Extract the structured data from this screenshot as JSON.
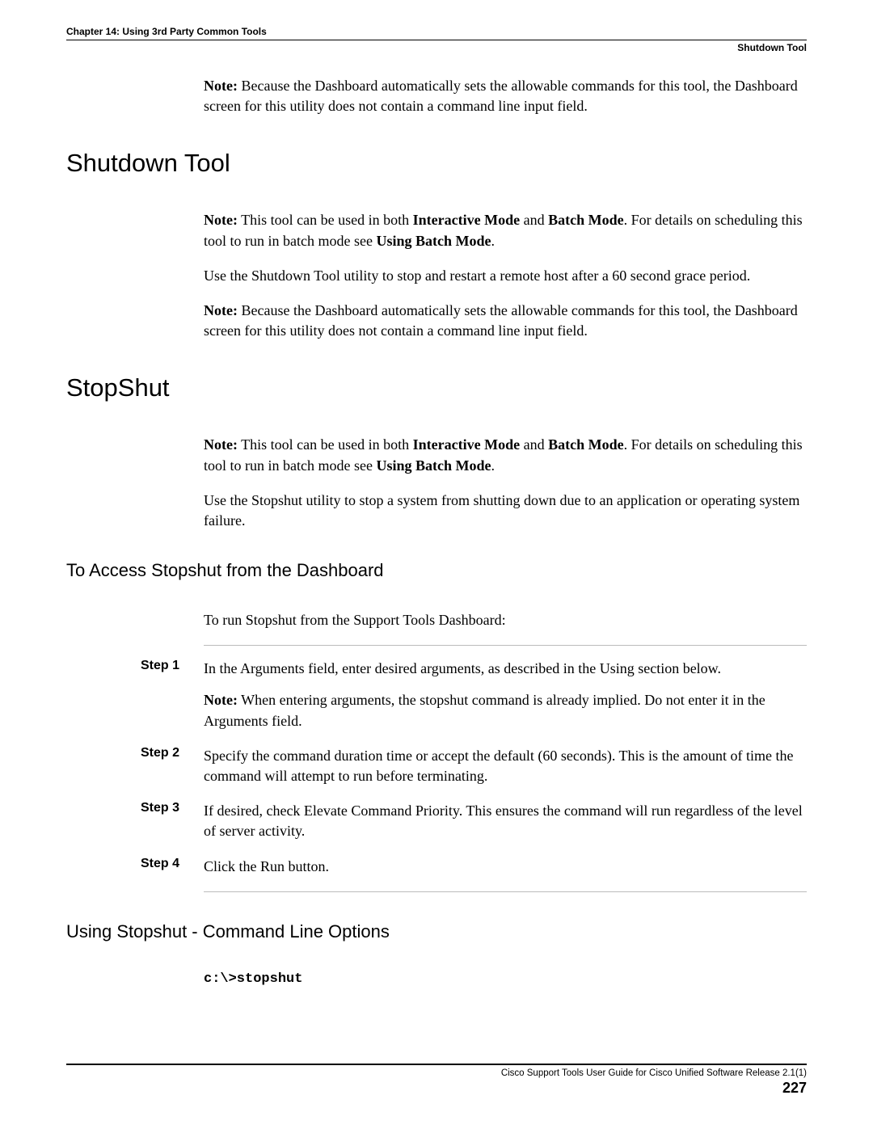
{
  "header": {
    "chapter": "Chapter 14: Using 3rd Party Common Tools",
    "section_label": "Shutdown Tool"
  },
  "intro_note": {
    "label": "Note:",
    "text": " Because the Dashboard automatically sets the allowable commands for this tool, the Dashboard screen for this utility does not contain a command line input field."
  },
  "shutdown": {
    "title": "Shutdown Tool",
    "note1_label": "Note:",
    "note1_a": " This tool can be used in both ",
    "note1_b": "Interactive Mode",
    "note1_c": " and ",
    "note1_d": "Batch Mode",
    "note1_e": ". For details on scheduling this tool to run in batch mode see ",
    "note1_f": "Using Batch Mode",
    "note1_g": ".",
    "para2": "Use the Shutdown Tool utility to stop and restart a remote host after a 60 second grace period.",
    "note2_label": "Note:",
    "note2_text": " Because the Dashboard automatically sets the allowable commands for this tool, the Dashboard screen for this utility does not contain a command line input field."
  },
  "stopshut": {
    "title": "StopShut",
    "note1_label": "Note:",
    "note1_a": " This tool can be used in both ",
    "note1_b": "Interactive Mode",
    "note1_c": " and ",
    "note1_d": "Batch Mode",
    "note1_e": ". For details on scheduling this tool to run in batch mode see ",
    "note1_f": "Using Batch Mode",
    "note1_g": ".",
    "para2": "Use the Stopshut utility to stop a system from shutting down due to an application or operating system failure."
  },
  "access": {
    "title": "To Access Stopshut from the Dashboard",
    "intro": "To run Stopshut from the Support Tools Dashboard:",
    "steps": [
      {
        "label": "Step 1",
        "text": "In the Arguments field, enter desired arguments, as described in the Using section below.",
        "note_label": "Note:",
        "note_text": " When entering arguments, the stopshut command is already implied. Do not enter it in the Arguments field."
      },
      {
        "label": "Step 2",
        "text": "Specify the command duration time or accept the default (60 seconds). This is the amount of time the command will attempt to run before terminating."
      },
      {
        "label": "Step 3",
        "text": "If desired, check Elevate Command Priority. This ensures the command will run regardless of the level of server activity."
      },
      {
        "label": "Step 4",
        "text": "Click the Run button."
      }
    ]
  },
  "cmdline": {
    "title": "Using Stopshut - Command Line Options",
    "code": "c:\\>stopshut"
  },
  "footer": {
    "guide": "Cisco Support Tools User Guide for Cisco Unified Software Release 2.1(1)",
    "page": "227"
  }
}
